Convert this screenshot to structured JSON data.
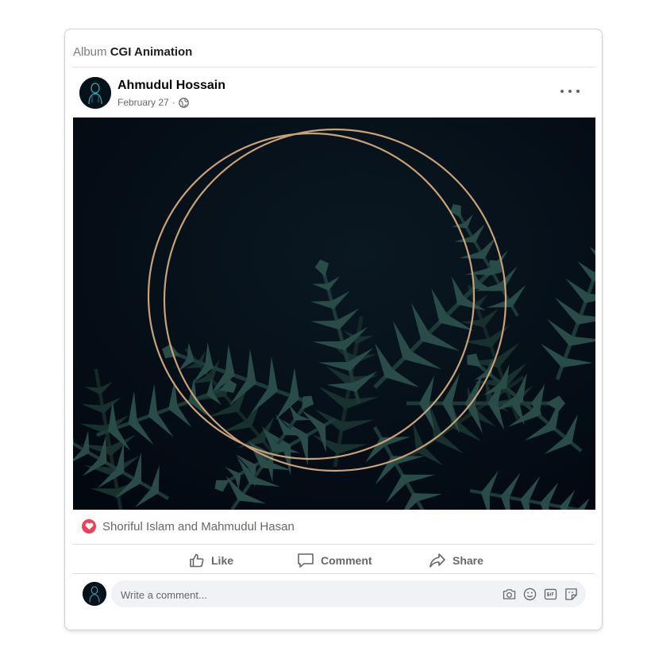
{
  "album": {
    "prefix": "Album",
    "title": "CGI Animation"
  },
  "post": {
    "author": "Ahmudul Hossain",
    "date": "February 27",
    "separator": "·",
    "audience_icon": "globe-icon",
    "more_icon": "more-options-icon"
  },
  "photo": {
    "description_icons": [
      "gold-double-circle-frame",
      "dark-fern-leaves"
    ]
  },
  "reactions": {
    "icon": "heart-reaction-icon",
    "names": "Shoriful Islam and Mahmudul Hasan"
  },
  "actions": {
    "like_label": "Like",
    "comment_label": "Comment",
    "share_label": "Share"
  },
  "comment_box": {
    "placeholder": "Write a comment...",
    "icons": [
      "camera-icon",
      "emoji-icon",
      "gif-icon",
      "sticker-icon"
    ]
  },
  "colors": {
    "heart": "#f33e58",
    "muted_text": "#65676b",
    "divider": "#dadde1",
    "input_bg": "#f0f2f5",
    "photo_bg": "#040b12",
    "frame_gold": "#c9a27a"
  }
}
